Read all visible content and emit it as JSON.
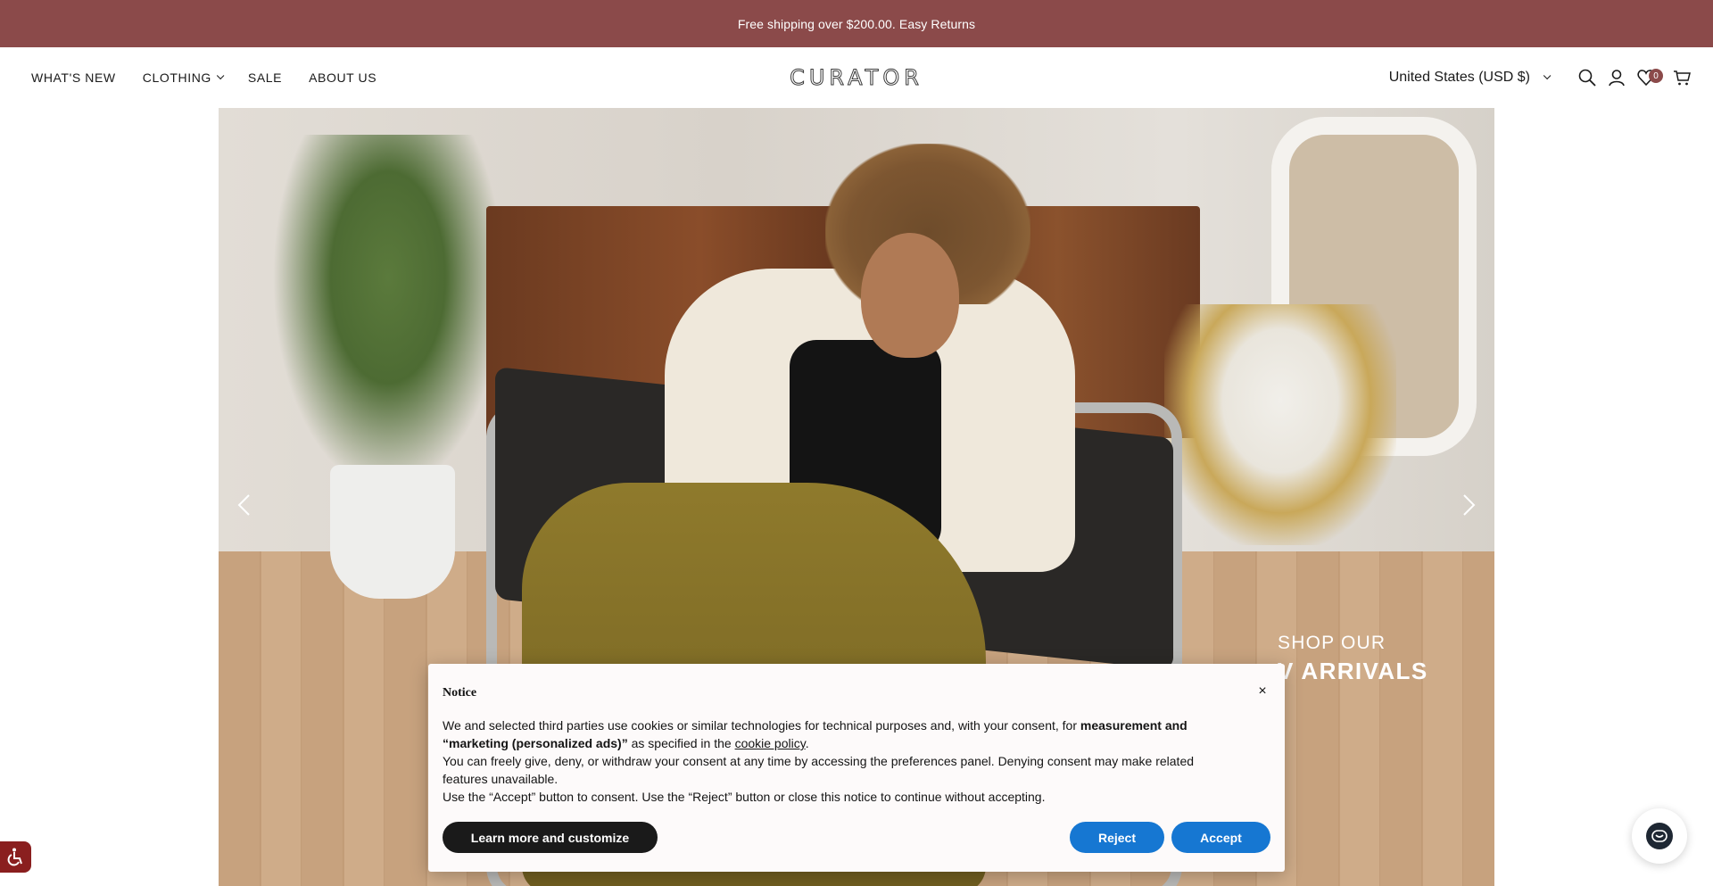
{
  "colors": {
    "announcement_bg": "#8b4a4a",
    "badge_bg": "#8b4a4a",
    "primary_button": "#1677d2",
    "dark_button": "#1a1a1a",
    "a11y_bg": "#8a1f1f",
    "chat_icon_bg": "#1e2733"
  },
  "announcement": {
    "text": "Free shipping over $200.00. Easy Returns"
  },
  "nav": {
    "items": [
      {
        "label": "WHAT'S NEW",
        "has_dropdown": false
      },
      {
        "label": "CLOTHING",
        "has_dropdown": true
      },
      {
        "label": "SALE",
        "has_dropdown": false
      },
      {
        "label": "ABOUT US",
        "has_dropdown": false
      }
    ]
  },
  "logo": {
    "text": "CURATOR"
  },
  "header_right": {
    "currency": "United States (USD $)",
    "wishlist_count": "0",
    "icons": [
      "search-icon",
      "account-icon",
      "wishlist-icon",
      "cart-icon"
    ]
  },
  "hero": {
    "text_small": "SHOP OUR",
    "text_big": "V ARRIVALS",
    "prev_icon": "chevron-left-icon",
    "next_icon": "chevron-right-icon"
  },
  "notice": {
    "title": "Notice",
    "para1_pre": "We and selected third parties use cookies or similar technologies for technical purposes and, with your consent, for ",
    "para1_bold": "measurement and “marketing (personalized ads)”",
    "para1_mid": " as specified in the ",
    "para1_link": "cookie policy",
    "para1_end": ".",
    "para2": "You can freely give, deny, or withdraw your consent at any time by accessing the preferences panel. Denying consent may make related features unavailable.",
    "para3": "Use the “Accept” button to consent. Use the “Reject” button or close this notice to continue without accepting.",
    "learn_label": "Learn more and customize",
    "reject_label": "Reject",
    "accept_label": "Accept",
    "close_glyph": "×"
  }
}
